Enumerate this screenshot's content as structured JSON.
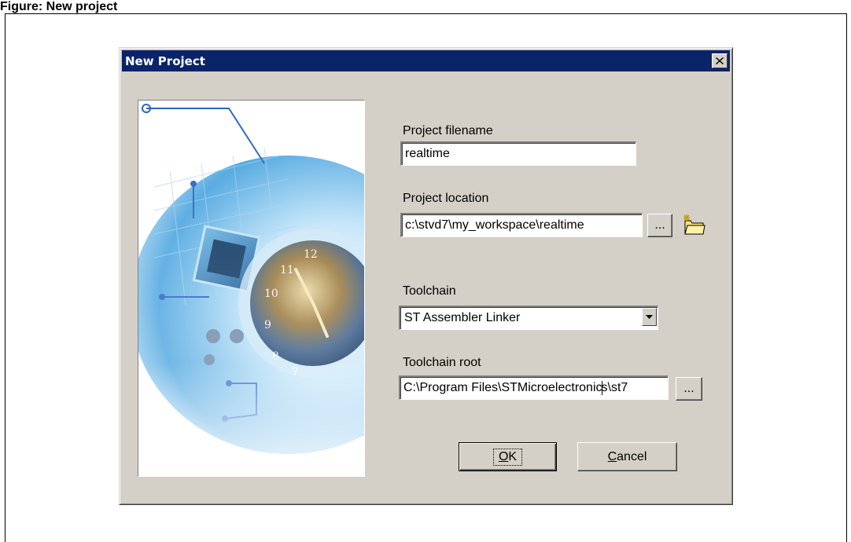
{
  "document": {
    "caption": "Figure: New project"
  },
  "dialog": {
    "title": "New Project",
    "close_icon": "close-icon",
    "fields": {
      "project_filename": {
        "label": "Project filename",
        "value": "realtime"
      },
      "project_location": {
        "label": "Project location",
        "value": "c:\\stvd7\\my_workspace\\realtime",
        "browse_label": "...",
        "new_folder_icon": "new-folder-icon"
      },
      "toolchain": {
        "label": "Toolchain",
        "selected": "ST Assembler Linker"
      },
      "toolchain_root": {
        "label": "Toolchain root",
        "value_before_caret": "C:\\Program Files\\STMicroelectronic",
        "value_after_caret": "s\\st7",
        "browse_label": "..."
      }
    },
    "buttons": {
      "ok": {
        "mnemonic": "O",
        "rest": "K"
      },
      "cancel": {
        "mnemonic": "C",
        "rest": "ancel"
      }
    }
  },
  "colors": {
    "dialog_face": "#d4d0c8",
    "titlebar": "#0a246a",
    "title_text": "#ffffff"
  }
}
